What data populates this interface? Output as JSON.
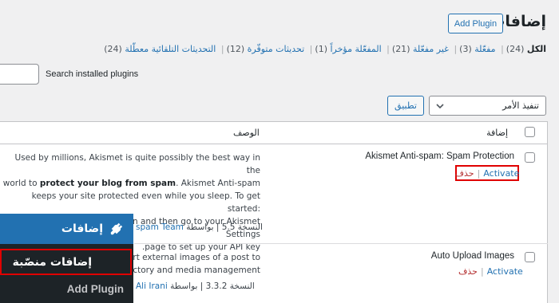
{
  "page": {
    "title": "إضافات",
    "add_plugin_label": "Add Plugin"
  },
  "filters": [
    {
      "label": "الكل",
      "count": "(24)",
      "current": true
    },
    {
      "label": "مفعّلة",
      "count": "(3)"
    },
    {
      "label": "غير مفعّلة",
      "count": "(21)"
    },
    {
      "label": "المفعّلة مؤخراً",
      "count": "(1)"
    },
    {
      "label": "تحديثات متوفّرة",
      "count": "(12)"
    },
    {
      "label": "التحديثات التلقائية معطّلة",
      "count": "(24)"
    }
  ],
  "search": {
    "label": "Search installed plugins",
    "value": ""
  },
  "bulk": {
    "selected": "تنفيذ الأمر",
    "apply_label": "تطبيق"
  },
  "table": {
    "col_plugin": "إضافة",
    "col_description": "الوصف",
    "rows": [
      {
        "name": "Akismet Anti-spam: Spam Protection",
        "activate": "Activate",
        "sep": "|",
        "delete": "حذف",
        "desc_lines": [
          "Used by millions, Akismet is quite possibly the best way in the",
          "world to",
          "protect your blog from spam",
          ". Akismet Anti-spam",
          "keeps your site protected even while you sleep. To get started:",
          "activate the Akismet plugin and then go to your Akismet Settings",
          "page to set up your API key."
        ],
        "version": "النسخة 5.5",
        "by": "بواسطة",
        "author": "spam Team"
      },
      {
        "name": "Auto Upload Images",
        "activate": "Activate",
        "sep": "|",
        "delete": "حذف",
        "desc_lines": [
          "pport external images of a post to",
          "directory and media management"
        ],
        "version": "النسخة 3.3.2",
        "by": "بواسطة",
        "author": "Ali Irani"
      }
    ]
  },
  "admin_menu": {
    "plugins_label": "إضافات",
    "installed_label": "إضافات منصّبة",
    "add_label": "Add Plugin"
  },
  "colors": {
    "accent": "#2271b1",
    "highlight": "#e00000",
    "menu_bg": "#1d2327"
  }
}
